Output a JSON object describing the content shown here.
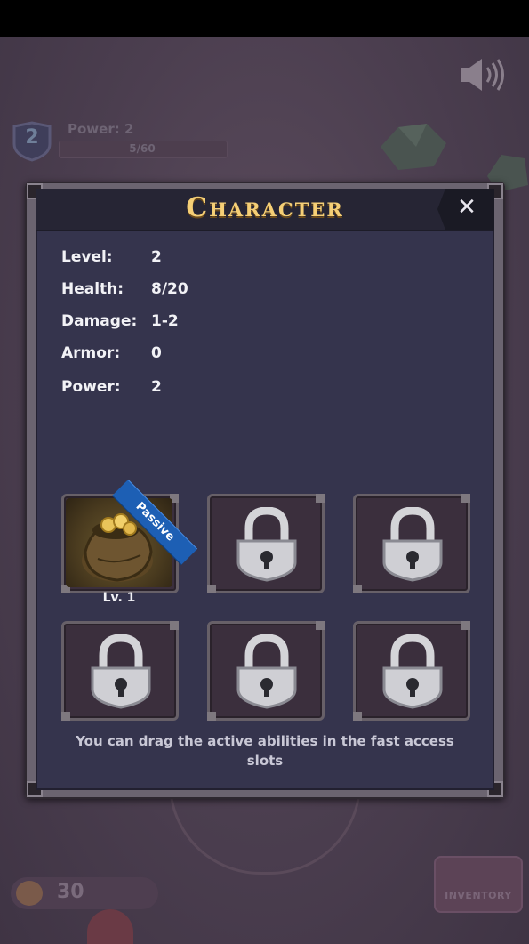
{
  "hud": {
    "player_level": "2",
    "power_label": "Power: 2",
    "xp_text": "5/60",
    "coin_count": "30",
    "inventory_label": "INVENTORY"
  },
  "modal": {
    "title": "Character",
    "close_glyph": "✕",
    "stats": [
      {
        "label": "Level:",
        "value": "2"
      },
      {
        "label": "Health:",
        "value": "8/20"
      },
      {
        "label": "Damage:",
        "value": "1-2"
      },
      {
        "label": "Armor:",
        "value": "0"
      },
      {
        "label": "Power:",
        "value": "2"
      }
    ],
    "abilities": [
      {
        "state": "unlocked",
        "icon": "coin-bag-icon",
        "tag": "Passive",
        "level": "Lv. 1"
      },
      {
        "state": "locked",
        "icon": "padlock-icon"
      },
      {
        "state": "locked",
        "icon": "padlock-icon"
      },
      {
        "state": "locked",
        "icon": "padlock-icon"
      },
      {
        "state": "locked",
        "icon": "padlock-icon"
      },
      {
        "state": "locked",
        "icon": "padlock-icon"
      }
    ],
    "hint": "You can drag the active abilities in the fast access slots"
  },
  "colors": {
    "title_gold": "#f5cf76",
    "panel_bg": "#35344d",
    "passive_blue": "#1d5fb4"
  }
}
